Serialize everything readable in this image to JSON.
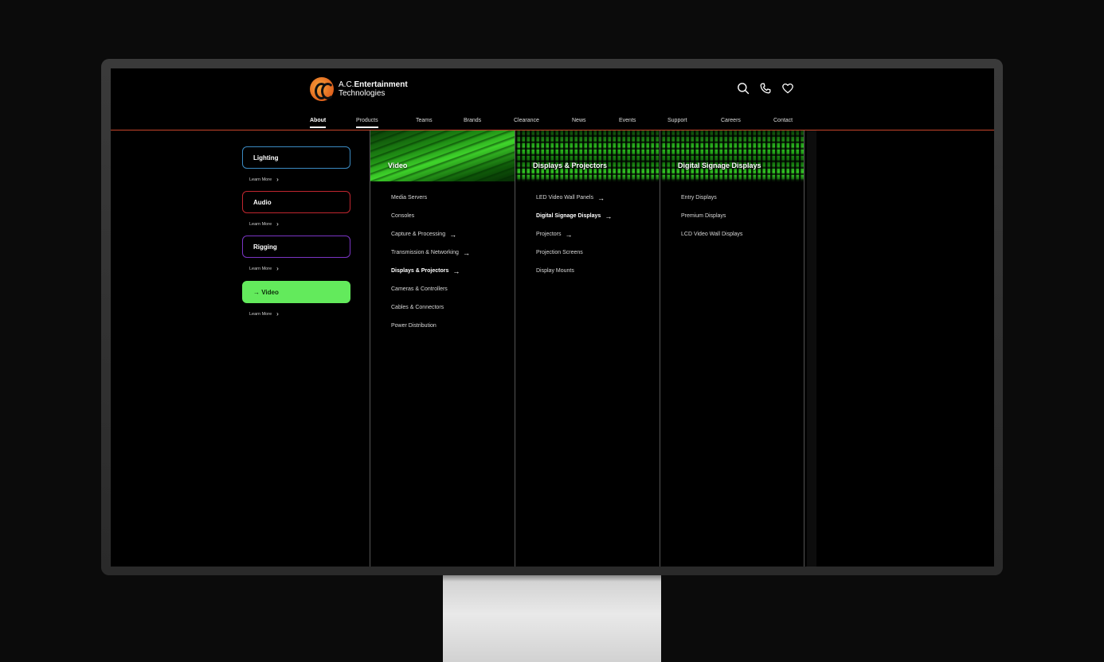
{
  "brand": {
    "name_prefix": "A.C.",
    "name_bold": "Entertainment",
    "name_line2": "Technologies",
    "accent_color": "#e0631d"
  },
  "header_icons": [
    "search-icon",
    "phone-icon",
    "heart-icon"
  ],
  "nav": {
    "items": [
      "About",
      "Products",
      "Teams",
      "Brands",
      "Clearance",
      "News",
      "Events",
      "Support",
      "Careers",
      "Contact"
    ],
    "active": "About",
    "hovered": "Products",
    "rule_color": "#c6452a"
  },
  "categories": [
    {
      "label": "Lighting",
      "learn_more": "Learn More",
      "border_color": "#3b8ac2"
    },
    {
      "label": "Audio",
      "learn_more": "Learn More",
      "border_color": "#c0262f"
    },
    {
      "label": "Rigging",
      "learn_more": "Learn More",
      "border_color": "#7a35c4"
    },
    {
      "label": "→ Video",
      "learn_more": "Learn More",
      "border_color": "#63ea5c",
      "selected": true
    }
  ],
  "columns": [
    {
      "title": "Video",
      "items": [
        {
          "label": "Media Servers",
          "arrow": false,
          "bold": false
        },
        {
          "label": "Consoles",
          "arrow": false,
          "bold": false
        },
        {
          "label": "Capture & Processing",
          "arrow": true,
          "bold": false
        },
        {
          "label": "Transmission & Networking",
          "arrow": true,
          "bold": false
        },
        {
          "label": "Displays & Projectors",
          "arrow": true,
          "bold": true
        },
        {
          "label": "Cameras & Controllers",
          "arrow": false,
          "bold": false
        },
        {
          "label": "Cables & Connectors",
          "arrow": false,
          "bold": false
        },
        {
          "label": "Power Distribution",
          "arrow": false,
          "bold": false
        }
      ]
    },
    {
      "title": "Displays & Projectors",
      "items": [
        {
          "label": "LED Video Wall Panels",
          "arrow": true,
          "bold": false
        },
        {
          "label": "Digital Signage Displays",
          "arrow": true,
          "bold": true
        },
        {
          "label": "Projectors",
          "arrow": true,
          "bold": false
        },
        {
          "label": "Projection Screens",
          "arrow": false,
          "bold": false
        },
        {
          "label": "Display Mounts",
          "arrow": false,
          "bold": false
        }
      ]
    },
    {
      "title": "Digital Signage Displays",
      "items": [
        {
          "label": "Entry Displays",
          "arrow": false,
          "bold": false
        },
        {
          "label": "Premium Displays",
          "arrow": false,
          "bold": false
        },
        {
          "label": "LCD Video Wall Displays",
          "arrow": false,
          "bold": false
        }
      ]
    }
  ],
  "arrow_glyph": "→",
  "chevron_glyph": "›"
}
